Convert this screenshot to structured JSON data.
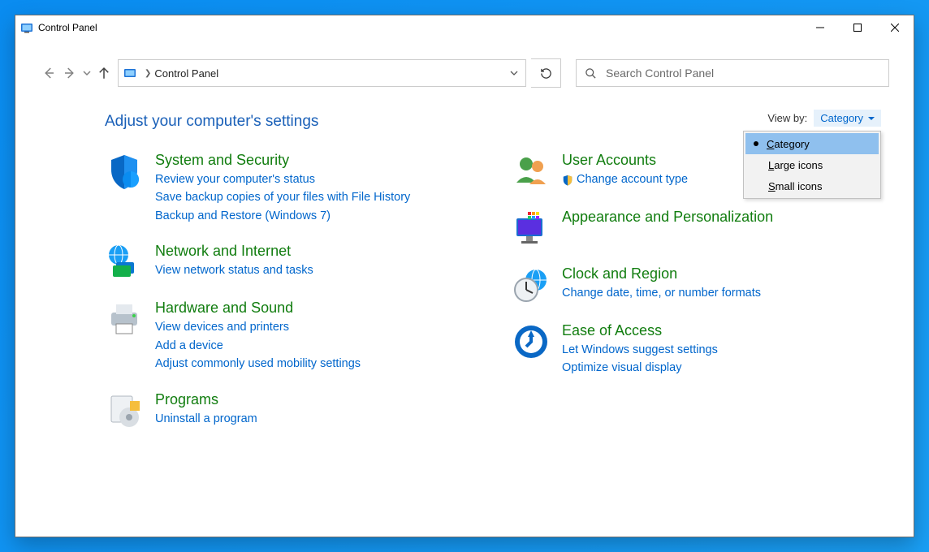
{
  "window": {
    "title": "Control Panel"
  },
  "addressbar": {
    "location": "Control Panel"
  },
  "search": {
    "placeholder": "Search Control Panel"
  },
  "page": {
    "heading": "Adjust your computer's settings"
  },
  "viewby": {
    "label": "View by:",
    "selected": "Category",
    "options": [
      "Category",
      "Large icons",
      "Small icons"
    ]
  },
  "categories": {
    "left": [
      {
        "id": "system-security",
        "title": "System and Security",
        "links": [
          "Review your computer's status",
          "Save backup copies of your files with File History",
          "Backup and Restore (Windows 7)"
        ]
      },
      {
        "id": "network-internet",
        "title": "Network and Internet",
        "links": [
          "View network status and tasks"
        ]
      },
      {
        "id": "hardware-sound",
        "title": "Hardware and Sound",
        "links": [
          "View devices and printers",
          "Add a device",
          "Adjust commonly used mobility settings"
        ]
      },
      {
        "id": "programs",
        "title": "Programs",
        "links": [
          "Uninstall a program"
        ]
      }
    ],
    "right": [
      {
        "id": "user-accounts",
        "title": "User Accounts",
        "links": [
          "Change account type"
        ],
        "shield": true
      },
      {
        "id": "appearance",
        "title": "Appearance and Personalization",
        "links": []
      },
      {
        "id": "clock-region",
        "title": "Clock and Region",
        "links": [
          "Change date, time, or number formats"
        ]
      },
      {
        "id": "ease-of-access",
        "title": "Ease of Access",
        "links": [
          "Let Windows suggest settings",
          "Optimize visual display"
        ]
      }
    ]
  }
}
